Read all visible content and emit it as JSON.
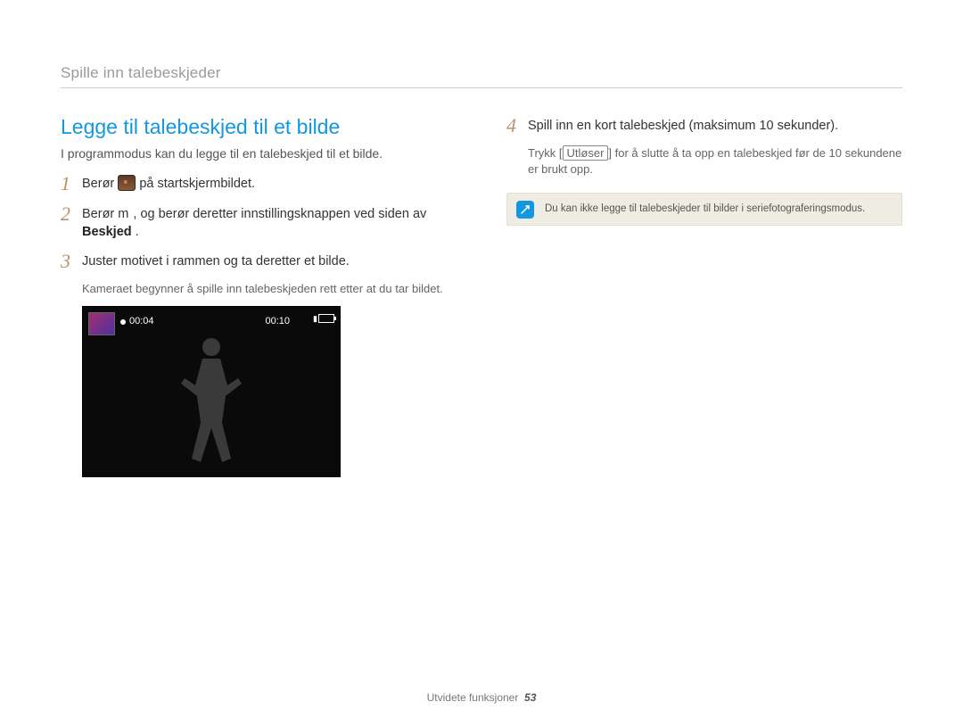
{
  "breadcrumb": "Spille inn talebeskjeder",
  "section_title": "Legge til talebeskjed til et bilde",
  "intro": "I programmodus kan du legge til en talebeskjed til et bilde.",
  "steps": {
    "s1_a": "Berør ",
    "s1_b": " på startskjermbildet.",
    "s2_a": "Berør ",
    "s2_m": "m",
    "s2_b": " , og berør deretter innstillingsknappen ved siden av ",
    "s2_bold": "Beskjed",
    "s2_c": ".",
    "s3": "Juster motivet i rammen og ta deretter et bilde.",
    "s3_sub": "Kameraet begynner å spille inn talebeskjeden rett etter at du tar bildet.",
    "s4": "Spill inn en kort talebeskjed (maksimum 10 sekunder).",
    "s4_sub_a": "Trykk [",
    "s4_btn": "Utløser",
    "s4_sub_b": "] for å slutte å ta opp en talebeskjed før de 10 sekundene er brukt opp."
  },
  "shot": {
    "rec_time": "00:04",
    "total_time": "00:10"
  },
  "note": "Du kan ikke legge til talebeskjeder til bilder i seriefotograferingsmodus.",
  "footer_label": "Utvidete funksjoner",
  "footer_page": "53"
}
